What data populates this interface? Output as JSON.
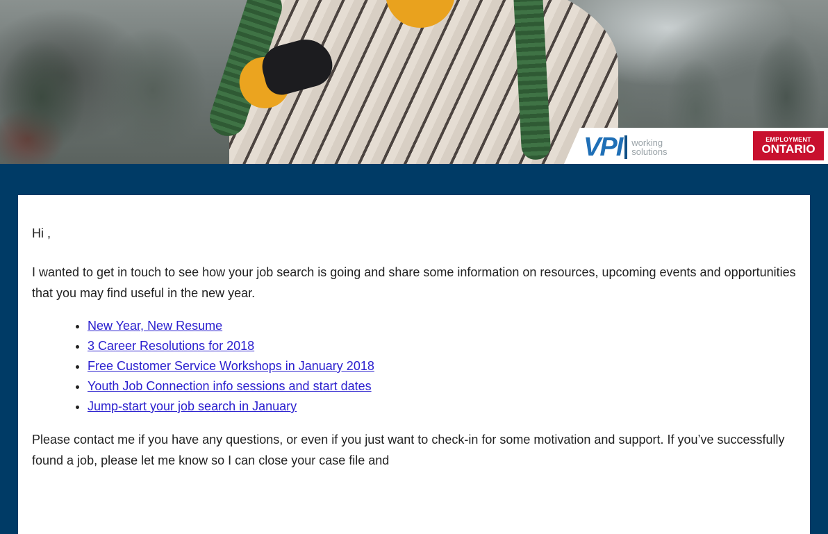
{
  "brand": {
    "vpi_mark": "VPI",
    "vpi_line1": "working",
    "vpi_line2": "solutions",
    "eo_line1": "EMPLOYMENT",
    "eo_line2": "ONTARIO",
    "vpi_color": "#1f6fb6",
    "eo_color": "#c8102e"
  },
  "colors": {
    "page_background": "#003b66",
    "link": "#2b20cf"
  },
  "email": {
    "greeting": "Hi ,",
    "intro": "I wanted to get in touch to see how your job search is going and share some information on resources, upcoming events and opportunities that you may find useful in the new year.",
    "links": [
      "New Year, New Resume",
      "3 Career Resolutions for 2018",
      "Free Customer Service Workshops in January 2018",
      "Youth Job Connection info sessions and start dates",
      "Jump-start your job search in January"
    ],
    "closing": "Please contact me if you have any questions, or even if you just want to check-in for some motivation and support. If you’ve successfully found a job, please let me know so I can close your case file and"
  }
}
